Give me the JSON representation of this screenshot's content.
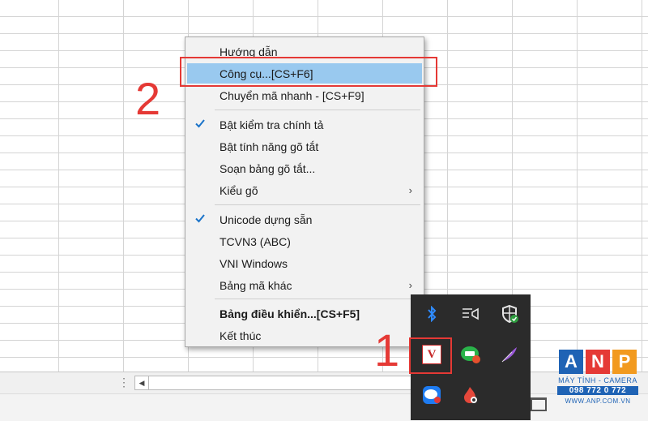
{
  "menu": {
    "items": [
      {
        "label": "Hướng dẫn"
      },
      {
        "label": "Công cụ...[CS+F6]"
      },
      {
        "label": "Chuyển mã nhanh - [CS+F9]"
      },
      {
        "label": "Bật kiểm tra chính tả",
        "checked": true
      },
      {
        "label": "Bật tính năng gõ tắt"
      },
      {
        "label": "Soạn bảng gõ tắt..."
      },
      {
        "label": "Kiểu gõ",
        "submenu_arrow": "›"
      },
      {
        "label": "Unicode dựng sẵn",
        "checked": true
      },
      {
        "label": "TCVN3 (ABC)"
      },
      {
        "label": "VNI Windows"
      },
      {
        "label": "Bảng mã khác",
        "submenu_arrow": "›"
      },
      {
        "label": "Bảng điều khiển...[CS+F5]",
        "bold": true
      },
      {
        "label": "Kết thúc"
      }
    ]
  },
  "annotations": {
    "step1": "1",
    "step2": "2",
    "color": "#e53935"
  },
  "tray": {
    "icons": [
      "bluetooth-icon",
      "speaker-icon",
      "windows-security-icon",
      "unikey-icon",
      "line-chat-icon",
      "feather-icon",
      "zalo-icon",
      "flame-app-icon"
    ],
    "unikey_label": "V"
  },
  "watermark": {
    "letters": [
      "A",
      "N",
      "P"
    ],
    "tagline": "MÁY TÍNH - CAMERA",
    "phone": "098 772 0 772",
    "website": "WWW.ANP.COM.VN",
    "colors": {
      "blue": "#1f63b5",
      "red": "#e53935",
      "orange": "#f29a1f"
    }
  },
  "colors": {
    "highlight": "#99c9ef",
    "menu_background": "#f2f2f2",
    "check": "#1a73c9"
  }
}
